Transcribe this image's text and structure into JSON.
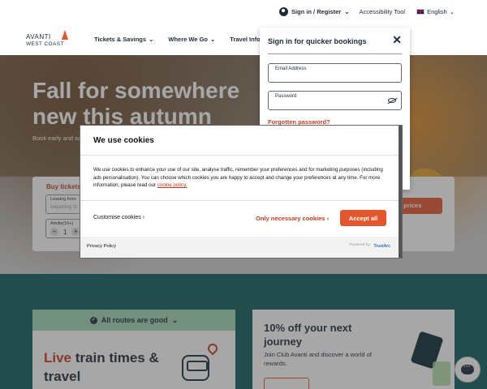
{
  "utility": {
    "signin_register": "Sign in / Register",
    "accessibility": "Accessibility Tool",
    "language": "English"
  },
  "logo": {
    "line1": "AVANTI",
    "line2": "WEST COAST"
  },
  "nav": {
    "items": [
      {
        "label": "Tickets & Savings"
      },
      {
        "label": "Where We Go"
      },
      {
        "label": "Travel Info"
      }
    ]
  },
  "hero": {
    "title": "Fall for somewhere new this autumn",
    "subtitle_visible": "Book early and sa"
  },
  "booking": {
    "title": "Buy tickets",
    "leaving_from_label": "Leaving from",
    "leaving_from_placeholder": "Departing St",
    "adults_label": "Adults(16+)",
    "adults_value": "1",
    "cta_visible": "s and prices"
  },
  "signin": {
    "title": "Sign in for quicker bookings",
    "email_label": "Email Address",
    "password_label": "Password",
    "forgot": "Forgotten password?"
  },
  "cookies": {
    "title": "We use cookies",
    "description": "We use cookies to enhance your use of our site, analyse traffic, remember your preferences and for marketing purposes (including ads personalisation). You can choose which cookies you are happy to accept and change your preferences at any time. For more information, please read our ",
    "policy_link": "cookie policy.",
    "customise": "Customise cookies",
    "necessary": "Only necessary cookies",
    "accept": "Accept all",
    "privacy": "Privacy Policy",
    "powered_by": "Powered by:",
    "provider": "TrustArc"
  },
  "routes_card": {
    "status": "All routes are good",
    "headline_accent": "Live",
    "headline_rest": "train times & travel"
  },
  "promo_card": {
    "headline": "10% off your next journey",
    "body": "Join Club Avanti and discover a world of rewards."
  },
  "colors": {
    "brand_orange": "#e4572e",
    "accent_red": "#c23c22",
    "navy": "#1d2b3a",
    "teal": "#0f5a5a",
    "mint": "#9fd6b3"
  }
}
